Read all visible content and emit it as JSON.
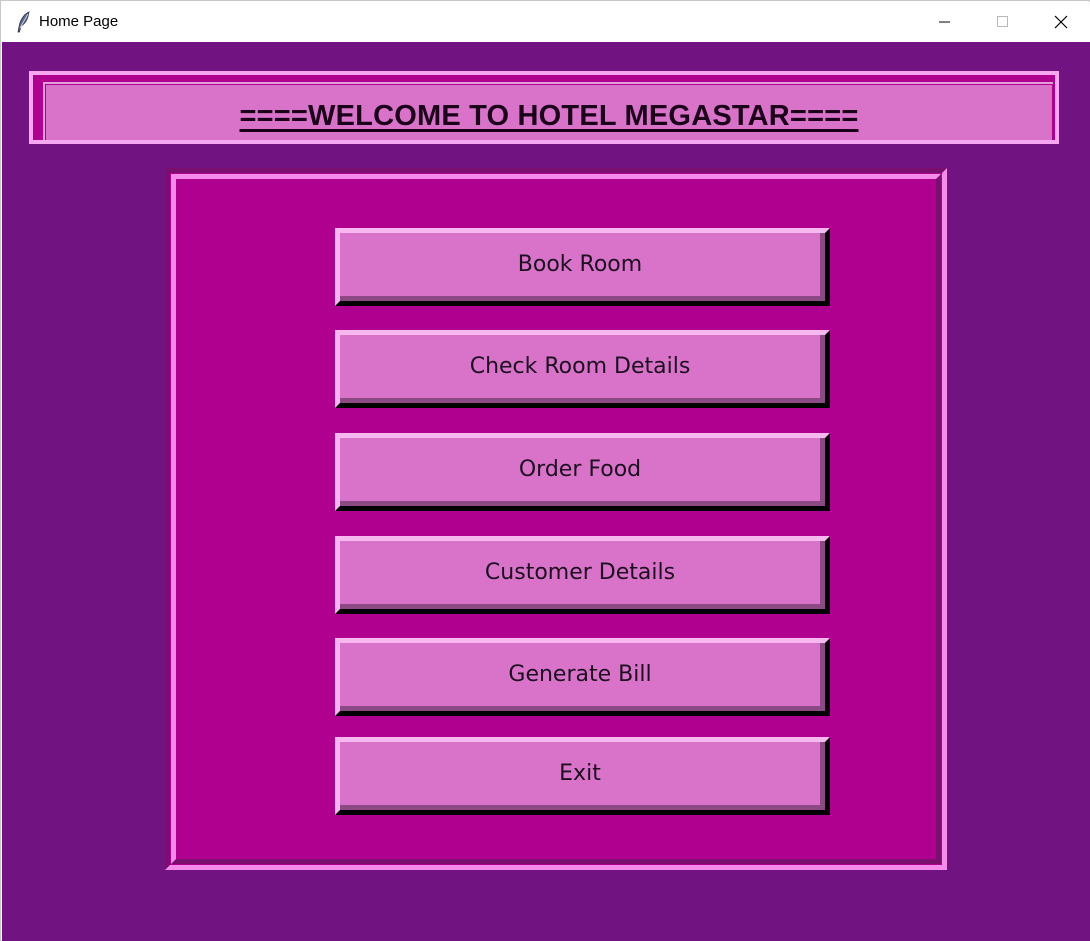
{
  "window": {
    "title": "Home Page",
    "icon": "feather-icon"
  },
  "header": {
    "title": "====WELCOME TO HOTEL MEGASTAR===="
  },
  "menu": {
    "items": [
      {
        "label": "Book Room"
      },
      {
        "label": "Check Room Details"
      },
      {
        "label": "Order Food"
      },
      {
        "label": "Customer Details"
      },
      {
        "label": "Generate Bill"
      },
      {
        "label": "Exit"
      }
    ]
  },
  "colors": {
    "background": "#721382",
    "panel": "#b0008f",
    "button": "#d873c9",
    "highlight": "#f58ceb"
  }
}
